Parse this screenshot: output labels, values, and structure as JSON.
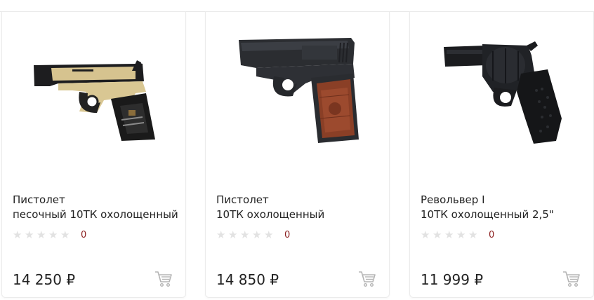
{
  "products": [
    {
      "title_line1": "Пистолет",
      "title_line2": "песочный 10ТК охолощенный",
      "rating_count": "0",
      "price": "14 250 ₽"
    },
    {
      "title_line1": "Пистолет",
      "title_line2": "10ТК охолощенный",
      "rating_count": "0",
      "price": "14 850 ₽"
    },
    {
      "title_line1": "Револьвер I",
      "title_line2": "10ТК охолощенный 2,5\"",
      "rating_count": "0",
      "price": "11 999 ₽"
    }
  ],
  "icons": {
    "star": "star-icon",
    "cart": "cart-icon"
  },
  "colors": {
    "rating_count": "#8b1e1e",
    "star_empty": "#e2e2e2",
    "cart_icon": "#b5b5b5"
  }
}
